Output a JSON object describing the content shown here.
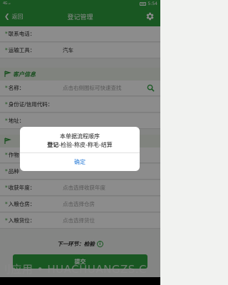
{
  "status_bar": {
    "signal": "4G ₊ᵢₗ",
    "time": "5:54"
  },
  "header": {
    "back_label": "返回",
    "title": "登记管理"
  },
  "form": {
    "contact_phone_label": "联系电话：",
    "transport_label": "运输工具：",
    "transport_value": "汽车",
    "customer_section": "客户信息",
    "name_label": "名称：",
    "name_placeholder": "点击右侧图标可快速查找",
    "id_label": "身份证/信用代码：",
    "address_label": "地址：",
    "work_label": "作物",
    "variety_label": "品种",
    "harvest_label": "收获年度：",
    "harvest_placeholder": "点击选择收获年度",
    "warehouse_label": "入粮仓房：",
    "warehouse_placeholder": "点击选择仓房",
    "slot_label": "入粮货位：",
    "slot_placeholder": "点击选择货位"
  },
  "footer": {
    "next_step": "下一环节：检验",
    "submit_label": "提交"
  },
  "dialog": {
    "line1": "本单据流程顺序",
    "line2_bold": "登记",
    "line2_rest": "-检验-称皮-称毛-结算",
    "ok_label": "确定"
  },
  "watermark": "刂应用 • HUACHUANGZS.C",
  "colors": {
    "primary": "#2f9f3e",
    "link": "#2f7fd8"
  }
}
